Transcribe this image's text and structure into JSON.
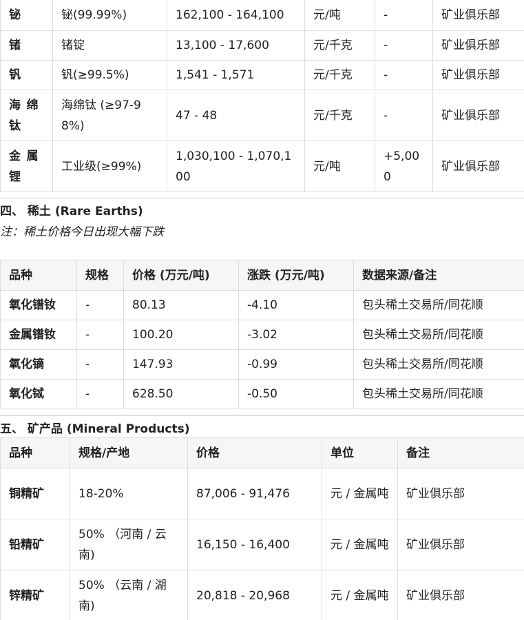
{
  "metals_table": {
    "rows": [
      {
        "name": "铋",
        "spec": "铋(99.99%)",
        "price": "162,100 - 164,100",
        "unit": "元/吨",
        "change": "-",
        "source": "矿业俱乐部"
      },
      {
        "name": "锗",
        "spec": "锗锭",
        "price": "13,100 - 17,600",
        "unit": "元/千克",
        "change": "-",
        "source": "矿业俱乐部"
      },
      {
        "name": "钒",
        "spec": "钒(≥99.5%)",
        "price": "1,541 - 1,571",
        "unit": "元/千克",
        "change": "-",
        "source": "矿业俱乐部"
      },
      {
        "name": "海绵钛",
        "spec": "海绵钛 (≥97-98%)",
        "price": "47 - 48",
        "unit": "元/千克",
        "change": "-",
        "source": "矿业俱乐部"
      },
      {
        "name": "金属锂",
        "spec": "工业级(≥99%)",
        "price": "1,030,100 - 1,070,100",
        "unit": "元/吨",
        "change": "+5,000",
        "source": "矿业俱乐部"
      }
    ]
  },
  "rare_earths": {
    "title": "四、 稀土 (Rare Earths)",
    "note": "注：稀土价格今日出现大幅下跌",
    "headers": [
      "品种",
      "规格",
      "价格 (万元/吨)",
      "涨跌 (万元/吨)",
      "数据来源/备注"
    ],
    "rows": [
      {
        "name": "氧化镨钕",
        "spec": "-",
        "price": "80.13",
        "change": "-4.10",
        "source": "包头稀土交易所/同花顺"
      },
      {
        "name": "金属镨钕",
        "spec": "-",
        "price": "100.20",
        "change": "-3.02",
        "source": "包头稀土交易所/同花顺"
      },
      {
        "name": "氧化镝",
        "spec": "-",
        "price": "147.93",
        "change": "-0.99",
        "source": "包头稀土交易所/同花顺"
      },
      {
        "name": "氧化铽",
        "spec": "-",
        "price": "628.50",
        "change": "-0.50",
        "source": "包头稀土交易所/同花顺"
      }
    ]
  },
  "mineral_products": {
    "title": "五、 矿产品 (Mineral Products)",
    "headers": [
      "品种",
      "规格/产地",
      "价格",
      "单位",
      "备注"
    ],
    "rows": [
      {
        "name": "铜精矿",
        "spec": "18-20%",
        "price": "87,006 - 91,476",
        "unit": "元 / 金属吨",
        "source": "矿业俱乐部"
      },
      {
        "name": "铅精矿",
        "spec": "50% （河南 / 云南)",
        "price": "16,150 - 16,400",
        "unit": "元 / 金属吨",
        "source": "矿业俱乐部"
      },
      {
        "name": "锌精矿",
        "spec": "50% （云南 / 湖南)",
        "price": "20,818 - 20,968",
        "unit": "元 / 金属吨",
        "source": "矿业俱乐部"
      }
    ]
  }
}
